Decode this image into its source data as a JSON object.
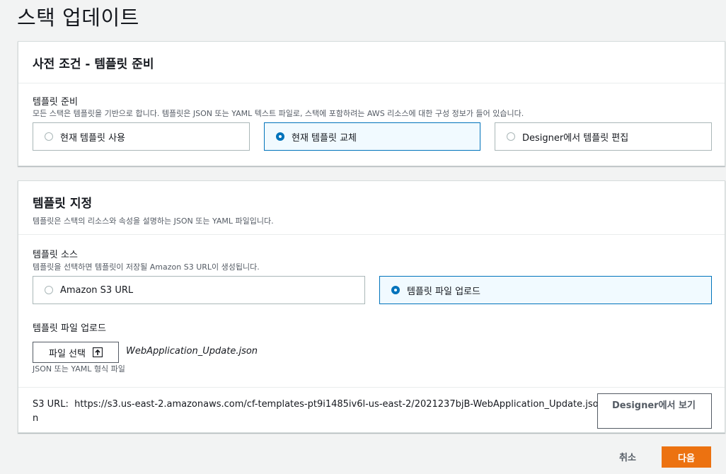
{
  "page": {
    "title": "스택 업데이트"
  },
  "prerequisite": {
    "title": "사전 조건 - 템플릿 준비",
    "field_label": "템플릿 준비",
    "field_desc": "모든 스택은 템플릿을 기반으로 합니다. 템플릿은 JSON 또는 YAML 텍스트 파일로, 스택에 포함하려는 AWS 리소스에 대한 구성 정보가 들어 있습니다.",
    "options": [
      {
        "label": "현재 템플릿 사용",
        "selected": false
      },
      {
        "label": "현재 템플릿 교체",
        "selected": true
      },
      {
        "label": "Designer에서 템플릿 편집",
        "selected": false
      }
    ]
  },
  "template_spec": {
    "title": "템플릿 지정",
    "desc": "템플릿은 스택의 리소스와 속성을 설명하는 JSON 또는 YAML 파일입니다.",
    "source_label": "템플릿 소스",
    "source_desc": "템플릿을 선택하면 템플릿이 저장될 Amazon S3 URL이 생성됩니다.",
    "source_options": [
      {
        "label": "Amazon S3 URL",
        "selected": false
      },
      {
        "label": "템플릿 파일 업로드",
        "selected": true
      }
    ],
    "upload_label": "템플릿 파일 업로드",
    "choose_file_label": "파일 선택",
    "file_name": "WebApplication_Update.json",
    "file_hint": "JSON 또는 YAML 형식 파일",
    "s3_url_label": "S3 URL:",
    "s3_url": "https://s3.us-east-2.amazonaws.com/cf-templates-pt9i1485iv6l-us-east-2/2021237bjB-WebApplication_Update.json",
    "designer_button": "Designer에서 보기"
  },
  "footer": {
    "cancel": "취소",
    "next": "다음"
  },
  "colors": {
    "accent": "#0073bb",
    "primary_button": "#ec7211"
  }
}
